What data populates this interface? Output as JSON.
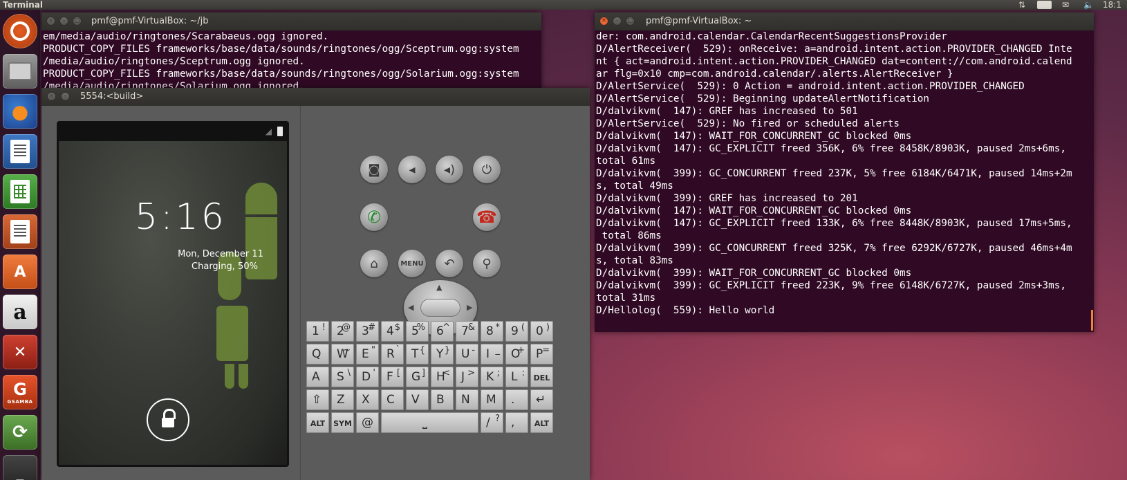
{
  "top_panel": {
    "app_title": "Terminal",
    "keyboard_layout": "En",
    "clock": "18:1"
  },
  "launcher": {
    "items": [
      {
        "name": "dash",
        "label": ""
      },
      {
        "name": "files",
        "label": ""
      },
      {
        "name": "firefox",
        "label": ""
      },
      {
        "name": "writer",
        "label": ""
      },
      {
        "name": "calc",
        "label": ""
      },
      {
        "name": "impress",
        "label": ""
      },
      {
        "name": "software-center",
        "label": ""
      },
      {
        "name": "amazon",
        "label": "a"
      },
      {
        "name": "system-settings",
        "label": ""
      },
      {
        "name": "gsamba",
        "label": "GSAMBA"
      },
      {
        "name": "software-updater",
        "label": ""
      },
      {
        "name": "terminal",
        "label": ""
      }
    ]
  },
  "term_left": {
    "title": "pmf@pmf-VirtualBox: ~/jb",
    "text": "em/media/audio/ringtones/Scarabaeus.ogg ignored.\nPRODUCT_COPY_FILES frameworks/base/data/sounds/ringtones/ogg/Sceptrum.ogg:system\n/media/audio/ringtones/Sceptrum.ogg ignored.\nPRODUCT_COPY_FILES frameworks/base/data/sounds/ringtones/ogg/Solarium.ogg:system\n/media/audio/ringtones/Solarium.ogg ignored."
  },
  "term_right": {
    "title": "pmf@pmf-VirtualBox: ~",
    "text": "der: com.android.calendar.CalendarRecentSuggestionsProvider\nD/AlertReceiver(  529): onReceive: a=android.intent.action.PROVIDER_CHANGED Inte\nnt { act=android.intent.action.PROVIDER_CHANGED dat=content://com.android.calend\nar flg=0x10 cmp=com.android.calendar/.alerts.AlertReceiver }\nD/AlertService(  529): 0 Action = android.intent.action.PROVIDER_CHANGED\nD/AlertService(  529): Beginning updateAlertNotification\nD/dalvikvm(  147): GREF has increased to 501\nD/AlertService(  529): No fired or scheduled alerts\nD/dalvikvm(  147): WAIT_FOR_CONCURRENT_GC blocked 0ms\nD/dalvikvm(  147): GC_EXPLICIT freed 356K, 6% free 8458K/8903K, paused 2ms+6ms,\ntotal 61ms\nD/dalvikvm(  399): GC_CONCURRENT freed 237K, 5% free 6184K/6471K, paused 14ms+2m\ns, total 49ms\nD/dalvikvm(  399): GREF has increased to 201\nD/dalvikvm(  147): WAIT_FOR_CONCURRENT_GC blocked 0ms\nD/dalvikvm(  147): GC_EXPLICIT freed 133K, 6% free 8448K/8903K, paused 17ms+5ms,\n total 86ms\nD/dalvikvm(  399): GC_CONCURRENT freed 325K, 7% free 6292K/6727K, paused 46ms+4m\ns, total 83ms\nD/dalvikvm(  399): WAIT_FOR_CONCURRENT_GC blocked 0ms\nD/dalvikvm(  399): GC_EXPLICIT freed 223K, 9% free 6148K/6727K, paused 2ms+3ms,\ntotal 31ms\nD/Hellolog(  559): Hello world"
  },
  "emulator": {
    "title": "5554:<build>",
    "lockscreen": {
      "time": "5:16",
      "date": "Mon, December 11",
      "charging": "Charging, 50%"
    },
    "controls": {
      "menu_label": "MENU"
    },
    "keyboard": {
      "row1": [
        [
          "1",
          "!"
        ],
        [
          "2",
          "@"
        ],
        [
          "3",
          "#"
        ],
        [
          "4",
          "$"
        ],
        [
          "5",
          "%"
        ],
        [
          "6",
          "^"
        ],
        [
          "7",
          "&"
        ],
        [
          "8",
          "*"
        ],
        [
          "9",
          "("
        ],
        [
          "0",
          ")"
        ]
      ],
      "row2": [
        [
          "Q",
          ""
        ],
        [
          "W",
          "~"
        ],
        [
          "E",
          "\""
        ],
        [
          "R",
          "`"
        ],
        [
          "T",
          "{"
        ],
        [
          "Y",
          "}"
        ],
        [
          "U",
          "-"
        ],
        [
          "I",
          "_"
        ],
        [
          "O",
          "+"
        ],
        [
          "P",
          "="
        ]
      ],
      "row3": [
        [
          "A",
          ""
        ],
        [
          "S",
          "\\"
        ],
        [
          "D",
          "'"
        ],
        [
          "F",
          "["
        ],
        [
          "G",
          "]"
        ],
        [
          "H",
          "<"
        ],
        [
          "J",
          ">"
        ],
        [
          "K",
          ";"
        ],
        [
          "L",
          ":"
        ],
        [
          "DEL",
          ""
        ]
      ],
      "row4": [
        [
          "",
          ""
        ],
        [
          "Z",
          ""
        ],
        [
          "X",
          ""
        ],
        [
          "C",
          ""
        ],
        [
          "V",
          ""
        ],
        [
          "B",
          ""
        ],
        [
          "N",
          ""
        ],
        [
          "M",
          ""
        ],
        [
          ".",
          ""
        ],
        [
          "",
          ""
        ]
      ],
      "row5_alt_left": "ALT",
      "row5_sym": "SYM",
      "row5_at": "@",
      "row5_slash": "/",
      "row5_slash_alt": "?",
      "row5_comma": ",",
      "row5_alt_right": "ALT"
    }
  },
  "colors": {
    "terminal_bg": "#300a24",
    "accent_orange": "#f0813a"
  }
}
